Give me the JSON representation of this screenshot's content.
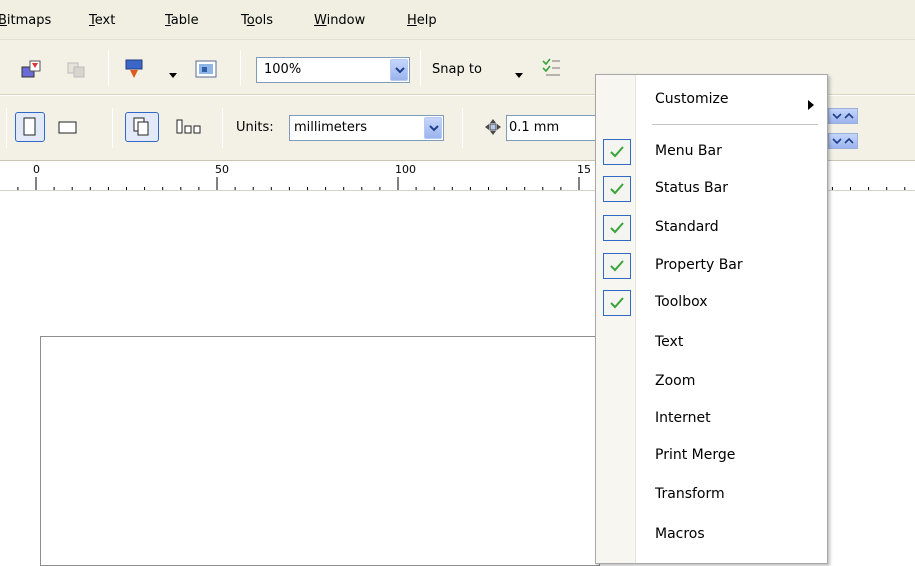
{
  "menubar": {
    "items": [
      {
        "label": "Bitmaps",
        "accel_index": 0
      },
      {
        "label": "Text",
        "accel_index": 0
      },
      {
        "label": "Table",
        "accel_index": 0
      },
      {
        "label": "Tools",
        "accel_index": 1
      },
      {
        "label": "Window",
        "accel_index": 0
      },
      {
        "label": "Help",
        "accel_index": 0
      }
    ]
  },
  "standard_toolbar": {
    "zoom_value": "100%",
    "snap_to_label": "Snap to"
  },
  "property_bar": {
    "units_label": "Units:",
    "units_value": "millimeters",
    "nudge_value": "0.1 mm"
  },
  "ruler": {
    "labels": [
      "0",
      "50",
      "100",
      "15"
    ]
  },
  "context_menu": {
    "items": [
      {
        "label": "Customize",
        "checked": false,
        "submenu": true
      },
      {
        "label": "Menu Bar",
        "checked": true
      },
      {
        "label": "Status Bar",
        "checked": true
      },
      {
        "label": "Standard",
        "checked": true
      },
      {
        "label": "Property Bar",
        "checked": true
      },
      {
        "label": "Toolbox",
        "checked": true
      },
      {
        "label": "Text",
        "checked": false
      },
      {
        "label": "Zoom",
        "checked": false
      },
      {
        "label": "Internet",
        "checked": false
      },
      {
        "label": "Print Merge",
        "checked": false
      },
      {
        "label": "Transform",
        "checked": false
      },
      {
        "label": "Macros",
        "checked": false
      }
    ]
  },
  "colors": {
    "check": "#3aa33a",
    "highlight_border": "#316ac5",
    "menubar_bg": "#f1efe2"
  }
}
